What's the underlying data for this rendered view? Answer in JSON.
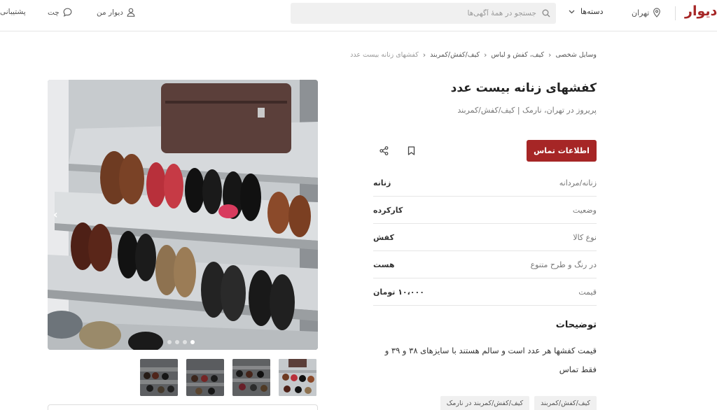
{
  "header": {
    "logo": "دیوار",
    "city": "تهران",
    "categories_label": "دسته‌ها",
    "search_placeholder": "جستجو در همهٔ آگهی‌ها",
    "my_divar": "دیوار من",
    "chat": "چت",
    "support": "پشتیبانی"
  },
  "breadcrumb": [
    "وسایل شخصی",
    "کیف، کفش و لباس",
    "کیف/کفش/کمربند",
    "کفشهای زنانه بیست عدد"
  ],
  "listing": {
    "title": "کفشهای زنانه بیست عدد",
    "subtitle": "پریروز در تهران، نارمک | کیف/کفش/کمربند",
    "contact_button": "اطلاعات تماس"
  },
  "attributes": [
    {
      "label": "زنانه/مردانه",
      "value": "زنانه"
    },
    {
      "label": "وضعیت",
      "value": "کارکرده"
    },
    {
      "label": "نوع کالا",
      "value": "کفش"
    },
    {
      "label": "در رنگ و طرح متنوع",
      "value": "هست"
    },
    {
      "label": "قیمت",
      "value": "۱۰،۰۰۰ تومان"
    }
  ],
  "description": {
    "title": "توضیحات",
    "body": "قیمت کفشها هر عدد است و سالم هستند با سایزهای ۳۸ و ۳۹ و فقط تماس"
  },
  "tags": [
    "کیف/کفش/کمربند",
    "کیف/کفش/کمربند در نارمک"
  ],
  "gallery": {
    "dot_count": 4,
    "active_dot": 3,
    "thumb_count": 4
  },
  "colors": {
    "brand": "#a62626"
  }
}
